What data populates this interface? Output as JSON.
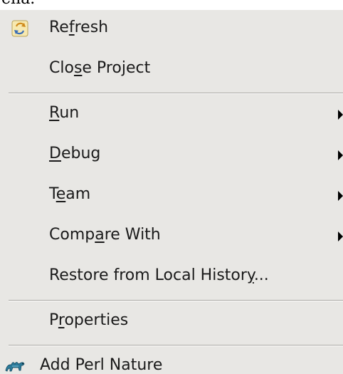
{
  "top_fragment": "ená.",
  "menu": {
    "items": [
      {
        "id": "refresh",
        "label_parts": [
          "Re",
          "f",
          "resh"
        ],
        "icon": "refresh-icon",
        "submenu": false
      },
      {
        "id": "close-project",
        "label_parts": [
          "Clo",
          "s",
          "e Project"
        ],
        "submenu": false
      },
      {
        "separator": true
      },
      {
        "id": "run",
        "label_parts": [
          "",
          "R",
          "un"
        ],
        "submenu": true
      },
      {
        "id": "debug",
        "label_parts": [
          "",
          "D",
          "ebug"
        ],
        "submenu": true
      },
      {
        "id": "team",
        "label_parts": [
          "T",
          "e",
          "am"
        ],
        "submenu": true
      },
      {
        "id": "compare-with",
        "label_parts": [
          "Comp",
          "a",
          "re With"
        ],
        "submenu": true
      },
      {
        "id": "restore-local-history",
        "label_parts": [
          "Restore from Local Histor",
          "y",
          "..."
        ],
        "submenu": false
      },
      {
        "separator": true
      },
      {
        "id": "properties",
        "label_parts": [
          "P",
          "r",
          "operties"
        ],
        "submenu": false
      },
      {
        "separator": true
      },
      {
        "id": "add-perl-nature",
        "label_parts": [
          "Add Perl Nature",
          "",
          ""
        ],
        "icon": "camel-icon",
        "submenu": false
      }
    ]
  },
  "colors": {
    "menu_background": "#e8e7e4",
    "text": "#1a1a1a",
    "separator_dark": "#a7a6a1",
    "separator_light": "#ffffff"
  }
}
